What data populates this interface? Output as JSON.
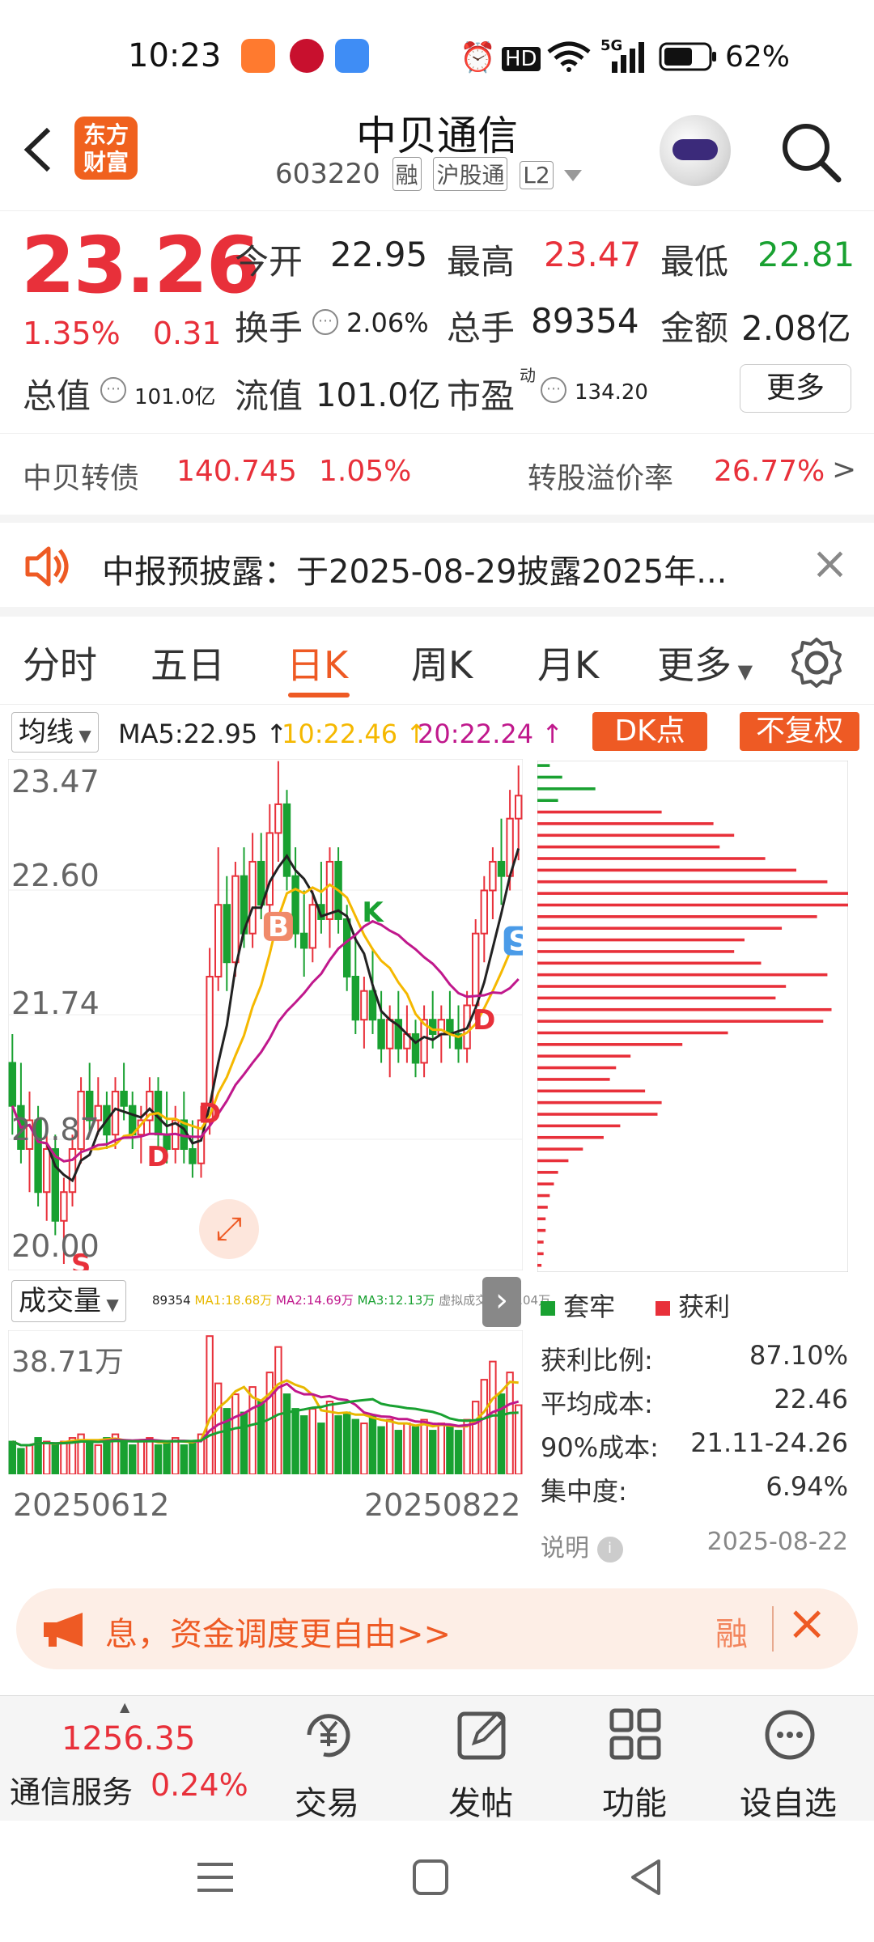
{
  "status_bar": {
    "time": "10:23",
    "indicators": "HD",
    "network": "5G",
    "battery": "62%"
  },
  "header": {
    "back_icon": "chevron-left-icon",
    "logo_text_1": "东方",
    "logo_text_2": "财富",
    "stock_name": "中贝通信",
    "stock_code": "603220",
    "tags": [
      "融",
      "沪股通",
      "L2"
    ],
    "search_icon": "search-icon"
  },
  "quote": {
    "price": "23.26",
    "change_pct": "1.35%",
    "change_amt": "0.31",
    "open_label": "今开",
    "open": "22.95",
    "high_label": "最高",
    "high": "23.47",
    "low_label": "最低",
    "low": "22.81",
    "turnover_label": "换手",
    "turnover": "2.06%",
    "volume_label": "总手",
    "volume": "89354",
    "amount_label": "金额",
    "amount": "2.08亿",
    "mktcap_label": "总值",
    "mktcap": "101.0亿",
    "float_label": "流值",
    "float_cap": "101.0亿",
    "pe_label": "市盈",
    "pe_sup": "动",
    "pe": "134.20",
    "more_label": "更多"
  },
  "convertible": {
    "name": "中贝转债",
    "price": "140.745",
    "pct": "1.05%",
    "premium_label": "转股溢价率",
    "premium": "26.77%",
    "arrow": ">"
  },
  "notice": {
    "text": "中报预披露：于2025-08-29披露2025年...",
    "close": "×"
  },
  "tabs": [
    "分时",
    "五日",
    "日K",
    "周K",
    "月K",
    "更多"
  ],
  "active_tab": "日K",
  "chart_toolbar": {
    "indicator": "均线",
    "ma5": "MA5:22.95",
    "ma10": "10:22.46",
    "ma20": "20:22.24",
    "dk_button": "DK点",
    "adjust_button": "不复权"
  },
  "volume_bar": {
    "label": "成交量",
    "legend": [
      "89354",
      "MA1:18.68万",
      "MA2:14.69万",
      "MA3:12.13万",
      "虚拟成交量:19.04万"
    ],
    "max_label": "38.71万"
  },
  "date_range": {
    "start": "20250612",
    "end": "20250822"
  },
  "cost_distribution": {
    "legend_trapped": "套牢",
    "legend_profit": "获利",
    "rows": [
      {
        "label": "获利比例:",
        "value": "87.10%"
      },
      {
        "label": "平均成本:",
        "value": "22.46"
      },
      {
        "label": "90%成本:",
        "value": "21.11-24.26"
      },
      {
        "label": "集中度:",
        "value": "6.94%"
      }
    ],
    "note_label": "说明",
    "date": "2025-08-22"
  },
  "banner": {
    "text": "息，资金调度更自由>>",
    "right_text": "融",
    "close": "×"
  },
  "bottom_nav": {
    "index_value": "1256.35",
    "index_name": "通信服务",
    "index_pct": "0.24%",
    "items": [
      "交易",
      "发帖",
      "功能",
      "设自选"
    ]
  },
  "chart_data": {
    "type": "candlestick",
    "price_axis_labels": [
      "23.47",
      "22.60",
      "21.74",
      "20.87",
      "20.00"
    ],
    "ylim": [
      20.0,
      23.47
    ],
    "signals": [
      "B",
      "S",
      "D",
      "D",
      "D",
      "K",
      "S"
    ],
    "series": [
      {
        "name": "MA5",
        "color": "#222222"
      },
      {
        "name": "10",
        "color": "#f5b800"
      },
      {
        "name": "20",
        "color": "#c0188c"
      }
    ],
    "ohlc": [
      [
        21.4,
        21.6,
        20.9,
        21.1
      ],
      [
        21.1,
        21.4,
        20.7,
        20.8
      ],
      [
        20.8,
        21.2,
        20.5,
        21.0
      ],
      [
        21.0,
        21.1,
        20.4,
        20.5
      ],
      [
        20.5,
        20.9,
        20.3,
        20.8
      ],
      [
        20.8,
        20.9,
        20.2,
        20.3
      ],
      [
        20.3,
        20.6,
        20.0,
        20.5
      ],
      [
        20.5,
        20.9,
        20.4,
        20.8
      ],
      [
        20.8,
        21.3,
        20.7,
        21.2
      ],
      [
        21.2,
        21.4,
        20.9,
        21.0
      ],
      [
        21.0,
        21.3,
        20.9,
        21.1
      ],
      [
        21.1,
        21.2,
        20.8,
        20.9
      ],
      [
        20.9,
        21.3,
        20.8,
        21.2
      ],
      [
        21.2,
        21.4,
        21.0,
        21.1
      ],
      [
        21.1,
        21.2,
        20.8,
        20.9
      ],
      [
        20.9,
        21.1,
        20.7,
        21.0
      ],
      [
        21.0,
        21.3,
        20.9,
        21.2
      ],
      [
        21.2,
        21.3,
        20.8,
        20.9
      ],
      [
        20.9,
        21.2,
        20.7,
        20.8
      ],
      [
        20.8,
        21.1,
        20.7,
        21.0
      ],
      [
        21.0,
        21.2,
        20.7,
        20.8
      ],
      [
        20.8,
        21.0,
        20.6,
        20.7
      ],
      [
        20.7,
        21.1,
        20.6,
        21.0
      ],
      [
        21.0,
        22.2,
        20.9,
        22.0
      ],
      [
        22.0,
        22.9,
        21.9,
        22.5
      ],
      [
        22.5,
        22.7,
        21.9,
        22.1
      ],
      [
        22.1,
        22.8,
        22.0,
        22.7
      ],
      [
        22.7,
        22.9,
        22.2,
        22.3
      ],
      [
        22.3,
        23.0,
        22.2,
        22.8
      ],
      [
        22.8,
        23.0,
        22.4,
        22.5
      ],
      [
        22.5,
        23.2,
        22.4,
        23.0
      ],
      [
        23.0,
        23.5,
        22.8,
        23.2
      ],
      [
        23.2,
        23.3,
        22.6,
        22.7
      ],
      [
        22.7,
        22.9,
        22.2,
        22.3
      ],
      [
        22.3,
        22.6,
        22.0,
        22.2
      ],
      [
        22.2,
        22.6,
        22.1,
        22.5
      ],
      [
        22.5,
        22.8,
        22.3,
        22.4
      ],
      [
        22.4,
        22.9,
        22.2,
        22.8
      ],
      [
        22.8,
        22.9,
        22.3,
        22.4
      ],
      [
        22.4,
        22.5,
        21.9,
        22.0
      ],
      [
        22.0,
        22.3,
        21.6,
        21.7
      ],
      [
        21.7,
        22.0,
        21.5,
        21.9
      ],
      [
        21.9,
        22.2,
        21.6,
        21.7
      ],
      [
        21.7,
        21.9,
        21.4,
        21.5
      ],
      [
        21.5,
        21.8,
        21.3,
        21.7
      ],
      [
        21.7,
        21.9,
        21.4,
        21.5
      ],
      [
        21.5,
        21.8,
        21.4,
        21.6
      ],
      [
        21.6,
        21.7,
        21.3,
        21.4
      ],
      [
        21.4,
        21.8,
        21.3,
        21.7
      ],
      [
        21.7,
        21.9,
        21.5,
        21.6
      ],
      [
        21.6,
        21.8,
        21.4,
        21.7
      ],
      [
        21.7,
        21.9,
        21.5,
        21.6
      ],
      [
        21.6,
        21.8,
        21.4,
        21.5
      ],
      [
        21.5,
        21.9,
        21.4,
        21.8
      ],
      [
        21.8,
        22.4,
        21.7,
        22.3
      ],
      [
        22.3,
        22.7,
        22.1,
        22.6
      ],
      [
        22.6,
        22.9,
        22.4,
        22.8
      ],
      [
        22.8,
        23.1,
        22.5,
        22.7
      ],
      [
        22.7,
        23.3,
        22.6,
        23.1
      ],
      [
        23.1,
        23.47,
        22.81,
        23.26
      ]
    ],
    "volume": {
      "ylim": [
        0,
        38.71
      ],
      "unit": "万",
      "values": [
        9,
        7,
        8,
        10,
        9,
        8,
        9,
        10,
        11,
        9,
        8,
        10,
        11,
        9,
        8,
        9,
        10,
        8,
        9,
        10,
        8,
        9,
        11,
        38,
        25,
        18,
        22,
        17,
        24,
        20,
        28,
        35,
        22,
        18,
        16,
        18,
        14,
        20,
        16,
        17,
        15,
        14,
        16,
        13,
        15,
        12,
        14,
        13,
        15,
        12,
        14,
        13,
        12,
        15,
        20,
        26,
        31,
        22,
        28,
        19
      ]
    },
    "cost_distribution_bars": {
      "trapped": [
        6,
        12,
        28,
        10
      ],
      "profit": [
        60,
        85,
        95,
        88,
        110,
        125,
        140,
        160,
        150,
        135,
        118,
        100,
        95,
        108,
        140,
        120,
        115,
        142,
        138,
        92,
        70,
        45,
        38,
        35,
        52,
        60,
        58,
        40,
        32,
        22,
        15,
        10,
        8,
        6,
        5,
        4,
        4,
        3,
        3,
        2
      ]
    }
  }
}
